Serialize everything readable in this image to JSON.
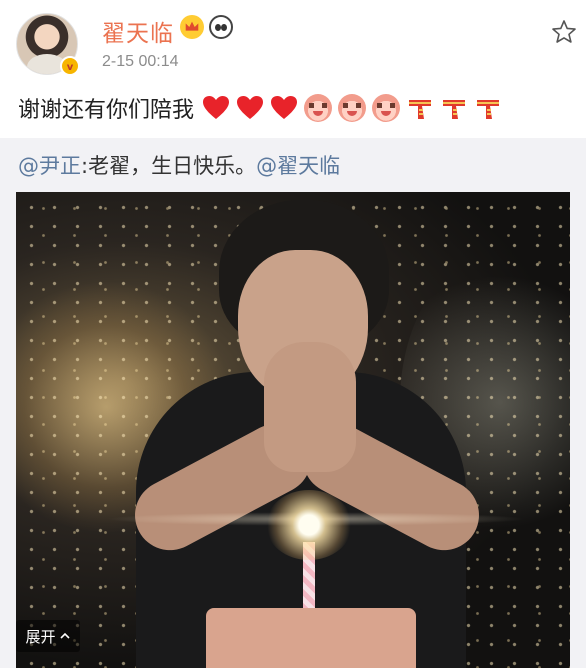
{
  "post": {
    "username": "翟天临",
    "timestamp": "2-15 00:14",
    "text": "谢谢还有你们陪我",
    "emojis": [
      "heart-icon",
      "heart-icon",
      "heart-icon",
      "blush-face-icon",
      "blush-face-icon",
      "blush-face-icon",
      "scarf-icon",
      "scarf-icon",
      "scarf-icon"
    ],
    "badges": [
      "crown-badge-icon",
      "panda-badge-icon"
    ]
  },
  "repost": {
    "mention_author": "@尹正",
    "text": ":老翟，生日快乐。",
    "mention_user": "@翟天临"
  },
  "expand_label": "展开",
  "expand_icon": "chevron-up-icon",
  "colors": {
    "username": "#eb7350",
    "mention": "#5d7a9e",
    "repost_bg": "#f2f2f5"
  }
}
